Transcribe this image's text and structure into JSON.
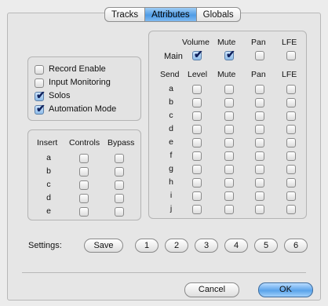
{
  "tabs": [
    {
      "label": "Tracks",
      "active": false
    },
    {
      "label": "Attributes",
      "active": true
    },
    {
      "label": "Globals",
      "active": false
    }
  ],
  "options": [
    {
      "label": "Record Enable",
      "checked": false
    },
    {
      "label": "Input Monitoring",
      "checked": false
    },
    {
      "label": "Solos",
      "checked": true
    },
    {
      "label": "Automation Mode",
      "checked": true
    }
  ],
  "inserts": {
    "headers": {
      "insert": "Insert",
      "controls": "Controls",
      "bypass": "Bypass"
    },
    "rows": [
      {
        "label": "a",
        "controls": false,
        "bypass": false
      },
      {
        "label": "b",
        "controls": false,
        "bypass": false
      },
      {
        "label": "c",
        "controls": false,
        "bypass": false
      },
      {
        "label": "d",
        "controls": false,
        "bypass": false
      },
      {
        "label": "e",
        "controls": false,
        "bypass": false
      }
    ]
  },
  "main": {
    "headers": {
      "volume": "Volume",
      "mute": "Mute",
      "pan": "Pan",
      "lfe": "LFE"
    },
    "label": "Main",
    "volume": true,
    "mute": true,
    "pan": false,
    "lfe": false
  },
  "sends": {
    "headers": {
      "send": "Send",
      "level": "Level",
      "mute": "Mute",
      "pan": "Pan",
      "lfe": "LFE"
    },
    "rows": [
      {
        "label": "a",
        "level": false,
        "mute": false,
        "pan": false,
        "lfe": false
      },
      {
        "label": "b",
        "level": false,
        "mute": false,
        "pan": false,
        "lfe": false
      },
      {
        "label": "c",
        "level": false,
        "mute": false,
        "pan": false,
        "lfe": false
      },
      {
        "label": "d",
        "level": false,
        "mute": false,
        "pan": false,
        "lfe": false
      },
      {
        "label": "e",
        "level": false,
        "mute": false,
        "pan": false,
        "lfe": false
      },
      {
        "label": "f",
        "level": false,
        "mute": false,
        "pan": false,
        "lfe": false
      },
      {
        "label": "g",
        "level": false,
        "mute": false,
        "pan": false,
        "lfe": false
      },
      {
        "label": "h",
        "level": false,
        "mute": false,
        "pan": false,
        "lfe": false
      },
      {
        "label": "i",
        "level": false,
        "mute": false,
        "pan": false,
        "lfe": false
      },
      {
        "label": "j",
        "level": false,
        "mute": false,
        "pan": false,
        "lfe": false
      }
    ]
  },
  "settings": {
    "label": "Settings:",
    "save": "Save",
    "presets": [
      "1",
      "2",
      "3",
      "4",
      "5",
      "6"
    ]
  },
  "footer": {
    "cancel": "Cancel",
    "ok": "OK"
  },
  "check_glyph": "✔"
}
